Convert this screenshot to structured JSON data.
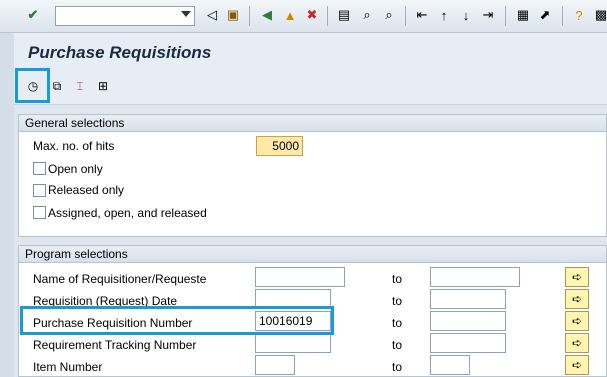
{
  "toolbar": {
    "command_value": "",
    "icons": [
      "enter-icon",
      "save-icon",
      "back-icon",
      "exit-icon",
      "cancel-icon",
      "print-icon",
      "find-icon",
      "find-next-icon",
      "first-page-icon",
      "prev-page-icon",
      "next-page-icon",
      "last-page-icon",
      "create-session-icon",
      "shortcut-icon",
      "help-icon",
      "customize-icon"
    ]
  },
  "page": {
    "title": "Purchase Requisitions"
  },
  "app_toolbar": {
    "icons": [
      "execute-icon",
      "get-variant-icon",
      "selection-options-icon",
      "multiple-selection-icon"
    ]
  },
  "general": {
    "header": "General selections",
    "max_hits_label": "Max. no. of hits",
    "max_hits_value": "5000",
    "open_only": "Open only",
    "released_only": "Released only",
    "assigned": "Assigned, open, and released"
  },
  "program": {
    "header": "Program selections",
    "to_label": "to",
    "rows": [
      {
        "label": "Name of Requisitioner/Requeste",
        "from": "",
        "to": ""
      },
      {
        "label": "Requisition (Request) Date",
        "from": "",
        "to": ""
      },
      {
        "label": "Purchase Requisition Number",
        "from": "10016019",
        "to": ""
      },
      {
        "label": "Requirement Tracking Number",
        "from": "",
        "to": ""
      },
      {
        "label": "Item Number",
        "from": "",
        "to": ""
      }
    ]
  },
  "colors": {
    "highlight": "#1a9ad6",
    "required_field": "#ffe9a8"
  }
}
